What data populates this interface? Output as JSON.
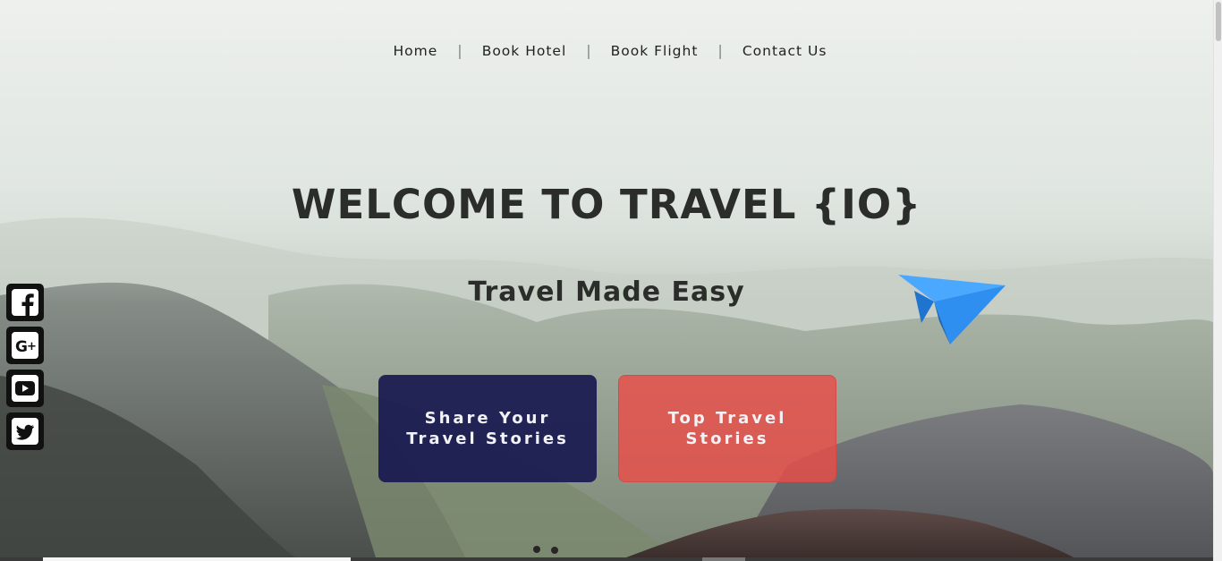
{
  "nav": {
    "items": [
      {
        "label": "Home"
      },
      {
        "label": "Book Hotel"
      },
      {
        "label": "Book Flight"
      },
      {
        "label": "Contact Us"
      }
    ],
    "separator": "|"
  },
  "hero": {
    "title": "WELCOME TO TRAVEL {IO}",
    "subtitle": "Travel Made Easy"
  },
  "buttons": {
    "share": {
      "line1": "Share Your",
      "line2": "Travel Stories"
    },
    "top": {
      "line1": "Top Travel",
      "line2": "Stories"
    }
  },
  "social": [
    {
      "icon": "facebook-icon"
    },
    {
      "icon": "google-plus-icon"
    },
    {
      "icon": "youtube-icon"
    },
    {
      "icon": "twitter-icon"
    }
  ],
  "colors": {
    "share_button": "#181950",
    "top_button": "#e94d48",
    "plane": "#2e8ff0",
    "heading": "#2b2d2a"
  }
}
